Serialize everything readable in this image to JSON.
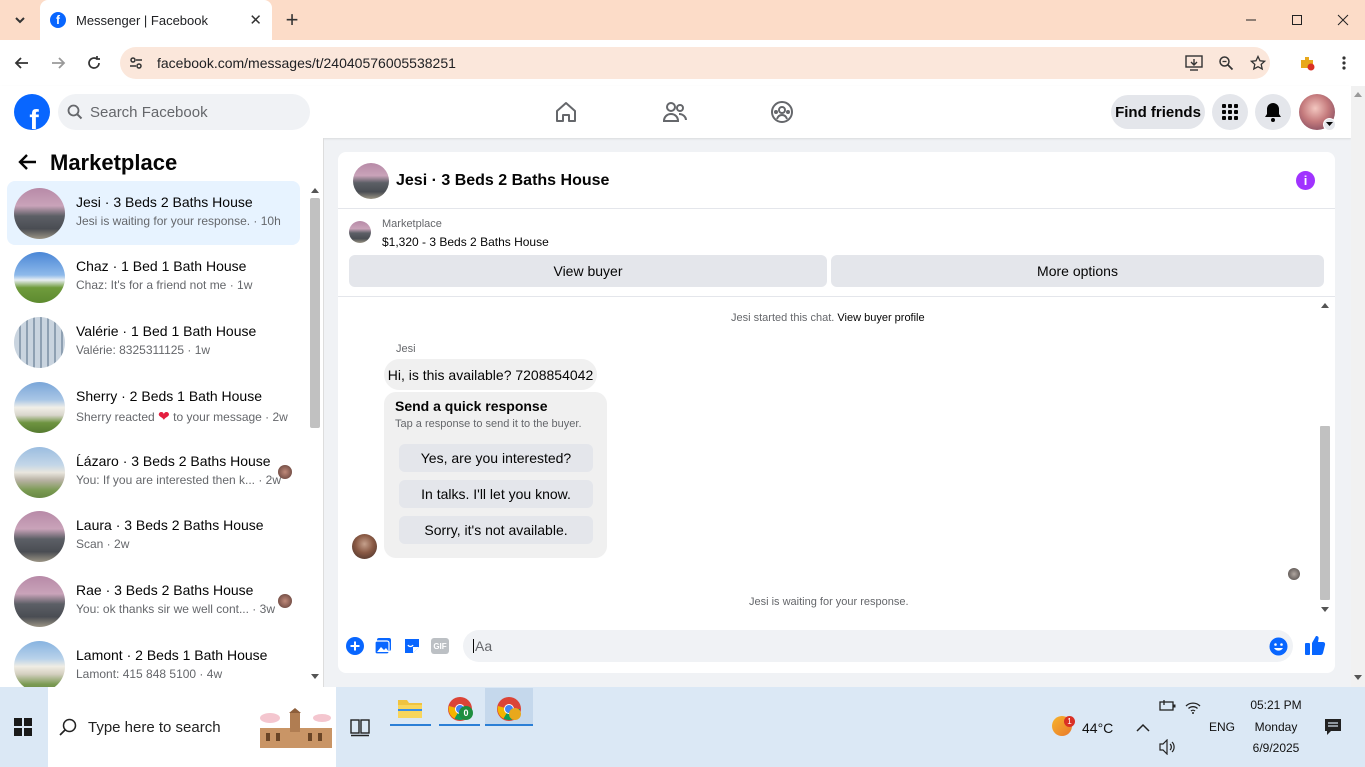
{
  "browser": {
    "tab_title": "Messenger | Facebook",
    "url": "facebook.com/messages/t/24040576005538251"
  },
  "fb_header": {
    "search_placeholder": "Search Facebook",
    "find_friends_label": "Find friends"
  },
  "sidebar": {
    "title": "Marketplace",
    "conversations": [
      {
        "name": "Jesi · 3 Beds 2 Baths House",
        "preview": "Jesi is waiting for your response. · 10h",
        "active": true
      },
      {
        "name": "Chaz · 1 Bed 1 Bath House",
        "preview": "Chaz: It's for a friend not me · 1w"
      },
      {
        "name": "Valérie · 1 Bed 1 Bath House",
        "preview": "Valérie: 8325311125 · 1w"
      },
      {
        "name": "Sherry · 2 Beds 1 Bath House",
        "preview_before": "Sherry reacted",
        "preview_after": "to your message · 2w"
      },
      {
        "name": "Ĺázaro · 3 Beds 2 Baths House",
        "preview": "You: If you are interested then k... · 2w"
      },
      {
        "name": "Laura · 3 Beds 2 Baths House",
        "preview": "Scan · 2w"
      },
      {
        "name": "Rae · 3 Beds 2 Baths House",
        "preview": "You: ok thanks sir we well cont... · 3w"
      },
      {
        "name": "Lamont · 2 Beds 1 Bath House",
        "preview": "Lamont: 415 848 5100 · 4w"
      }
    ]
  },
  "chat": {
    "title": "Jesi · 3 Beds 2 Baths House",
    "listing_label": "Marketplace",
    "listing_detail": "$1,320 - 3 Beds 2 Baths House",
    "view_buyer_label": "View buyer",
    "more_options_label": "More options",
    "started_text": "Jesi started this chat.",
    "view_profile_link": "View buyer profile",
    "sender_name": "Jesi",
    "message_text": "Hi, is this available? 7208854042",
    "quick_title": "Send a quick response",
    "quick_subtitle": "Tap a response to send it to the buyer.",
    "quick_responses": [
      "Yes, are you interested?",
      "In talks. I'll let you know.",
      "Sorry, it's not available."
    ],
    "waiting_text": "Jesi is waiting for your response.",
    "composer_placeholder": "Aa",
    "gif_label": "GIF"
  },
  "taskbar": {
    "search_placeholder": "Type here to search",
    "temperature": "44°C",
    "weather_badge": "1",
    "language": "ENG",
    "time": "05:21 PM",
    "day": "Monday",
    "date": "6/9/2025",
    "chrome_badge": "0"
  },
  "colors": {
    "fb_blue": "#0866ff",
    "tab_bar": "#fcdcc8",
    "active_row": "#e7f3ff",
    "info_purple": "#a033ff",
    "taskbar": "#dbe8f5"
  }
}
